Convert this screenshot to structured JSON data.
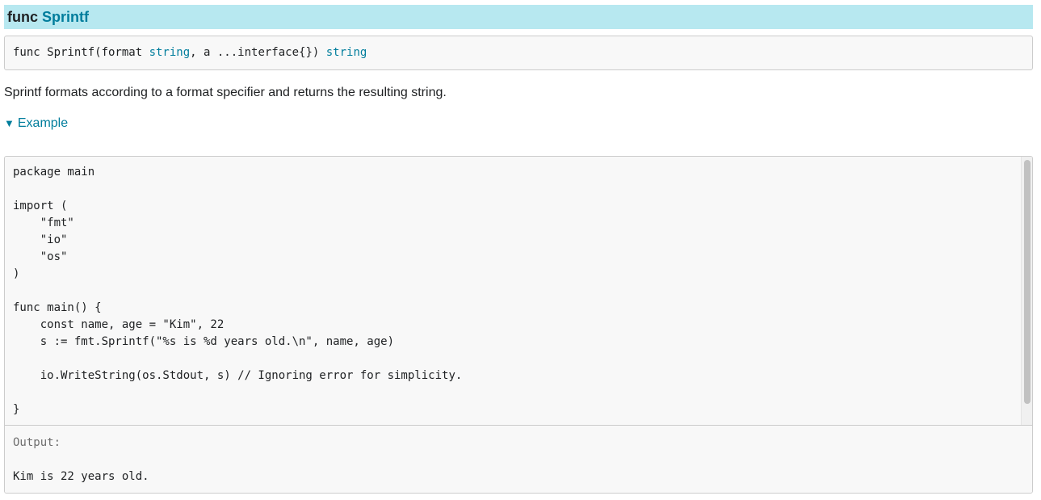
{
  "header": {
    "keyword": "func",
    "name": "Sprintf"
  },
  "signature": {
    "part1": "func Sprintf(format ",
    "type1": "string",
    "part2": ", a ...interface{}) ",
    "type2": "string"
  },
  "description": "Sprintf formats according to a format specifier and returns the resulting string.",
  "example": {
    "toggle_icon": "▼",
    "toggle_label": "Example",
    "code_lines": [
      "package main",
      "",
      "import (",
      "    \"fmt\"",
      "    \"io\"",
      "    \"os\"",
      ")",
      "",
      "func main() {",
      "    const name, age = \"Kim\", 22",
      "    s := fmt.Sprintf(\"%s is %d years old.\\n\", name, age)",
      "",
      "    io.WriteString(os.Stdout, s) // Ignoring error for simplicity.",
      "",
      "}"
    ],
    "output_label": "Output:",
    "output_text": "Kim is 22 years old."
  },
  "colors": {
    "header_bg": "#b7e8f0",
    "link": "#007d9c",
    "code_bg": "#f8f8f8"
  }
}
